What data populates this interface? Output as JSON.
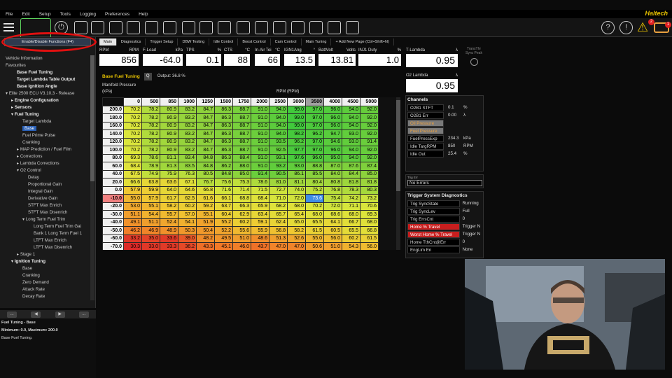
{
  "menu": [
    "File",
    "Edit",
    "Setup",
    "Tools",
    "Logging",
    "Preferences",
    "Help"
  ],
  "brand": "Haltech",
  "toolbar": {
    "alerts_badge": "2",
    "engine_badge": "1"
  },
  "left": {
    "function_button": "Enable/Disable Functions (F4)",
    "tree": [
      {
        "label": "Vehicle Information",
        "indent": 1,
        "bold": false
      },
      {
        "label": "Favourites",
        "indent": 1,
        "bold": false
      },
      {
        "label": "Base Fuel Tuning",
        "indent": 3,
        "bold": true
      },
      {
        "label": "Target Lambda Table Output",
        "indent": 3,
        "bold": true
      },
      {
        "label": "Base Ignition Angle",
        "indent": 3,
        "bold": true
      },
      {
        "label": "Elite 2500 ECU V3.10.3 - Release",
        "indent": 1,
        "bold": false,
        "arrow": "▾"
      },
      {
        "label": "Engine Configuration",
        "indent": 2,
        "bold": true,
        "arrow": "▸"
      },
      {
        "label": "Sensors",
        "indent": 2,
        "bold": true,
        "arrow": "▸"
      },
      {
        "label": "Fuel Tuning",
        "indent": 2,
        "bold": true,
        "arrow": "▾"
      },
      {
        "label": "Target Lambda",
        "indent": 4,
        "bold": false
      },
      {
        "label": "Base",
        "indent": 4,
        "bold": false,
        "selected": true
      },
      {
        "label": "Fuel Prime Pulse",
        "indent": 4,
        "bold": false
      },
      {
        "label": "Cranking",
        "indent": 4,
        "bold": false
      },
      {
        "label": "MAP Prediction / Fuel Film",
        "indent": 3,
        "bold": false,
        "arrow": "▸"
      },
      {
        "label": "Corrections",
        "indent": 3,
        "bold": false,
        "arrow": "▸"
      },
      {
        "label": "Lambda Corrections",
        "indent": 3,
        "bold": false,
        "arrow": "▸"
      },
      {
        "label": "O2 Control",
        "indent": 3,
        "bold": false,
        "arrow": "▾"
      },
      {
        "label": "Delay",
        "indent": 5,
        "bold": false
      },
      {
        "label": "Proportional Gain",
        "indent": 5,
        "bold": false
      },
      {
        "label": "Integral Gain",
        "indent": 5,
        "bold": false
      },
      {
        "label": "Derivative Gain",
        "indent": 5,
        "bold": false
      },
      {
        "label": "STFT Max Enrich",
        "indent": 5,
        "bold": false
      },
      {
        "label": "STFT Max Disenrich",
        "indent": 5,
        "bold": false
      },
      {
        "label": "Long Term Fuel Trim",
        "indent": 4,
        "bold": false,
        "arrow": "▾"
      },
      {
        "label": "Long Term Fuel Trim Gai",
        "indent": 6,
        "bold": false
      },
      {
        "label": "Bank 1 Long Term Fuel 1",
        "indent": 6,
        "bold": false
      },
      {
        "label": "LTFT Max Enrich",
        "indent": 6,
        "bold": false
      },
      {
        "label": "LTFT Max Disenrich",
        "indent": 6,
        "bold": false
      },
      {
        "label": "Stage 1",
        "indent": 3,
        "bold": false,
        "arrow": "▸"
      },
      {
        "label": "Ignition Tuning",
        "indent": 2,
        "bold": true,
        "arrow": "▾"
      },
      {
        "label": "Base",
        "indent": 4,
        "bold": false
      },
      {
        "label": "Cranking",
        "indent": 4,
        "bold": false
      },
      {
        "label": "Zero Demand",
        "indent": 4,
        "bold": false
      },
      {
        "label": "Attack Rate",
        "indent": 4,
        "bold": false
      },
      {
        "label": "Decay Rate",
        "indent": 4,
        "bold": false
      }
    ],
    "nav": [
      "...",
      "◀",
      "▶",
      "..."
    ],
    "info_title": "Fuel Tuning - Base",
    "info_range": "Minimum: 0.0, Maximum: 200.0",
    "info_desc": "Base Fuel Tuning."
  },
  "tabs": [
    "Main",
    "Diagnostics",
    "Trigger Setup",
    "DBW Testing",
    "Idle Control",
    "Boost Control",
    "Cam Control",
    "Main Tuning",
    "+ Add New Page (Ctrl+Shift+N)"
  ],
  "gauges": [
    {
      "name": "RPM",
      "unit": "RPM",
      "value": "856"
    },
    {
      "name": "F-Load",
      "unit": "kPa",
      "value": "-64.0"
    },
    {
      "name": "TPS",
      "unit": "%",
      "value": "0.1"
    },
    {
      "name": "CTS",
      "unit": "°C",
      "value": "88"
    },
    {
      "name": "In-Air Tei",
      "unit": "°C",
      "value": "66"
    },
    {
      "name": "IGN1Ang",
      "unit": "°",
      "value": "13.5"
    },
    {
      "name": "BattVolt",
      "unit": "Volts",
      "value": "13.81"
    },
    {
      "name": "INJ1 Duty",
      "unit": "%",
      "value": "1.0"
    }
  ],
  "tlambda": {
    "name": "T-Lambda",
    "unit": "λ",
    "value": "0.95"
  },
  "o2lambda": {
    "name": "O2 Lambda",
    "unit": "λ",
    "value": "0.95"
  },
  "transthr": "TransThr Sync Peak",
  "table": {
    "title": "Base Fuel Tuning",
    "search": "Q",
    "output": "Output: 36.8 %",
    "ylabel1": "Manifold Pressure",
    "ylabel2": "(kPa)",
    "xlabel": "RPM (RPM)",
    "cols": [
      "0",
      "500",
      "850",
      "1000",
      "1250",
      "1500",
      "1750",
      "2000",
      "2500",
      "3000",
      "3500",
      "4000",
      "4500",
      "5000"
    ],
    "rows": [
      "200.0",
      "180.0",
      "160.0",
      "140.0",
      "120.0",
      "100.0",
      "80.0",
      "60.0",
      "40.0",
      "20.0",
      "0.0",
      "-10.0",
      "-20.0",
      "-30.0",
      "-40.0",
      "-50.0",
      "-60.0",
      "-70.0"
    ],
    "values": [
      [
        "70.2",
        "78.2",
        "80.9",
        "83.2",
        "84.7",
        "86.3",
        "88.7",
        "91.0",
        "94.0",
        "99.0",
        "97.0",
        "96.0",
        "94.0",
        "92.0"
      ],
      [
        "70.2",
        "78.2",
        "80.9",
        "83.2",
        "84.7",
        "86.3",
        "88.7",
        "91.0",
        "94.0",
        "99.0",
        "97.0",
        "96.0",
        "94.0",
        "92.0"
      ],
      [
        "70.2",
        "78.2",
        "80.9",
        "83.2",
        "84.7",
        "86.3",
        "88.7",
        "91.0",
        "94.0",
        "99.0",
        "97.0",
        "96.0",
        "94.0",
        "92.0"
      ],
      [
        "70.2",
        "78.2",
        "80.9",
        "83.2",
        "84.7",
        "86.3",
        "88.7",
        "91.0",
        "94.0",
        "98.2",
        "96.2",
        "94.7",
        "93.0",
        "92.0"
      ],
      [
        "70.2",
        "78.2",
        "80.9",
        "83.2",
        "84.7",
        "86.3",
        "88.7",
        "91.0",
        "93.5",
        "96.2",
        "97.0",
        "94.6",
        "93.0",
        "91.4"
      ],
      [
        "70.2",
        "78.2",
        "80.9",
        "83.2",
        "84.7",
        "86.3",
        "88.7",
        "91.0",
        "92.5",
        "97.7",
        "97.0",
        "96.0",
        "94.0",
        "92.0"
      ],
      [
        "69.3",
        "78.6",
        "81.1",
        "83.4",
        "84.8",
        "86.3",
        "88.4",
        "91.0",
        "93.1",
        "97.6",
        "96.0",
        "95.0",
        "94.0",
        "92.0"
      ],
      [
        "68.4",
        "78.9",
        "81.3",
        "83.5",
        "84.8",
        "86.2",
        "88.0",
        "91.0",
        "93.2",
        "93.0",
        "88.8",
        "87.0",
        "87.6",
        "87.4"
      ],
      [
        "67.5",
        "74.9",
        "75.9",
        "76.3",
        "80.5",
        "84.8",
        "85.0",
        "91.4",
        "90.5",
        "86.1",
        "85.5",
        "84.0",
        "84.4",
        "85.0"
      ],
      [
        "66.6",
        "63.8",
        "63.6",
        "67.1",
        "76.7",
        "75.6",
        "75.3",
        "78.6",
        "81.0",
        "81.1",
        "80.4",
        "80.8",
        "81.8",
        "81.8"
      ],
      [
        "57.9",
        "59.9",
        "64.0",
        "64.6",
        "66.8",
        "71.6",
        "71.4",
        "71.5",
        "72.7",
        "74.0",
        "75.2",
        "76.8",
        "78.3",
        "80.3"
      ],
      [
        "55.0",
        "57.9",
        "61.7",
        "62.5",
        "61.6",
        "66.1",
        "68.8",
        "68.4",
        "71.0",
        "72.0",
        "73.6",
        "75.4",
        "74.2",
        "73.2"
      ],
      [
        "53.0",
        "55.1",
        "58.2",
        "60.2",
        "59.2",
        "63.7",
        "66.3",
        "65.9",
        "68.2",
        "68.0",
        "70.2",
        "72.0",
        "71.1",
        "70.6"
      ],
      [
        "51.1",
        "54.4",
        "55.7",
        "57.0",
        "55.1",
        "60.4",
        "62.9",
        "63.4",
        "65.7",
        "65.4",
        "68.0",
        "68.6",
        "68.0",
        "69.3"
      ],
      [
        "49.1",
        "51.1",
        "52.4",
        "54.1",
        "51.9",
        "55.2",
        "60.2",
        "59.1",
        "62.4",
        "65.0",
        "65.5",
        "64.1",
        "66.7",
        "68.0"
      ],
      [
        "46.2",
        "46.9",
        "48.9",
        "50.3",
        "50.4",
        "52.2",
        "55.6",
        "55.9",
        "56.8",
        "58.2",
        "61.5",
        "60.5",
        "65.5",
        "66.8"
      ],
      [
        "33.2",
        "35.0",
        "33.6",
        "39.0",
        "48.2",
        "49.5",
        "51.0",
        "48.6",
        "51.3",
        "52.6",
        "55.0",
        "56.0",
        "60.2",
        "61.5"
      ],
      [
        "30.3",
        "33.0",
        "33.3",
        "36.2",
        "43.3",
        "45.1",
        "46.0",
        "43.7",
        "47.0",
        "47.0",
        "50.6",
        "51.0",
        "54.3",
        "56.0"
      ]
    ],
    "highlight_col": 10,
    "highlight_row": 11
  },
  "channels": {
    "title": "Channels",
    "rows": [
      {
        "name": "O2B1 STFT",
        "value": "0.1",
        "unit": "%",
        "style": ""
      },
      {
        "name": "O2B1 Err",
        "value": "0.00",
        "unit": "λ",
        "style": ""
      },
      {
        "name": "Oil Pressure",
        "value": "",
        "unit": "",
        "style": "gray"
      },
      {
        "name": "Fuel Pressure",
        "value": "",
        "unit": "",
        "style": "gray"
      },
      {
        "name": "FuelPressExp",
        "value": "234.3",
        "unit": "kPa",
        "style": ""
      },
      {
        "name": "Idle TargRPM",
        "value": "850",
        "unit": "RPM",
        "style": ""
      },
      {
        "name": "Idle Out",
        "value": "25.4",
        "unit": "%",
        "style": ""
      }
    ]
  },
  "trig_err": {
    "label": "Trig Err",
    "value": "No Errors"
  },
  "trigger": {
    "title": "Trigger System Diagnostics",
    "rows": [
      {
        "name": "Trig SyncState",
        "value": "Running",
        "style": ""
      },
      {
        "name": "Trig SyncLev",
        "value": "Full",
        "style": ""
      },
      {
        "name": "Trig ErrsCnt",
        "value": "0",
        "style": ""
      },
      {
        "name": "Home % Travel",
        "value": "Trigger N",
        "style": "red"
      },
      {
        "name": "Worst Home % Travel",
        "value": "Trigger N",
        "style": "red"
      },
      {
        "name": "Home TthCnt@Err",
        "value": "0",
        "style": ""
      },
      {
        "name": "EngLim En",
        "value": "None",
        "style": ""
      }
    ]
  }
}
